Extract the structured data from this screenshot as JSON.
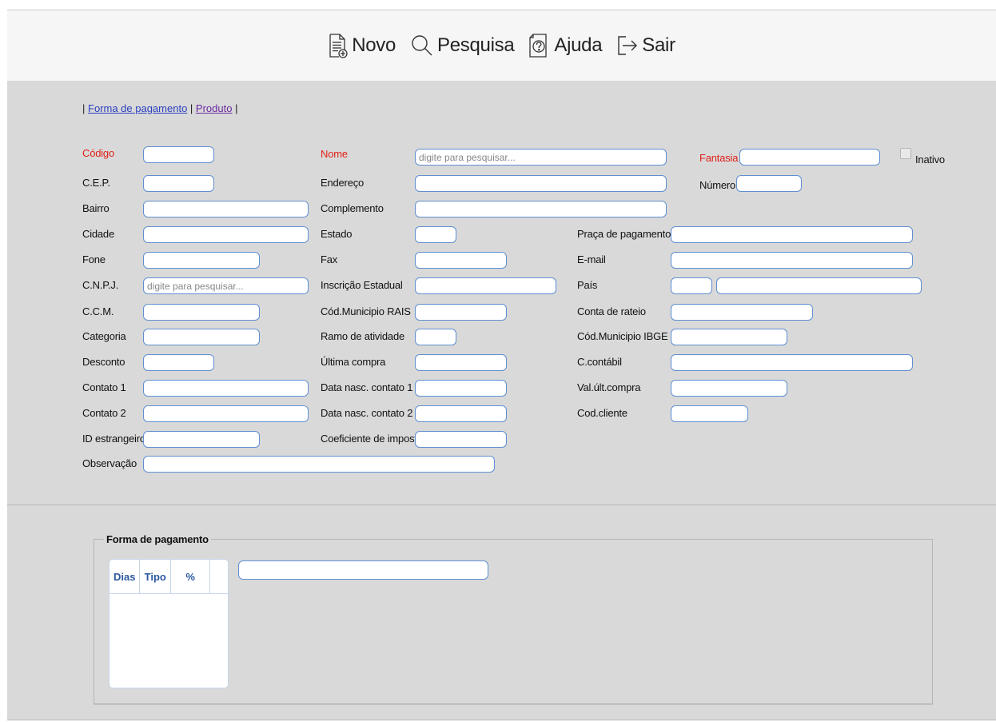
{
  "toolbar": {
    "novo": "Novo",
    "pesquisa": "Pesquisa",
    "ajuda": "Ajuda",
    "sair": "Sair"
  },
  "links": {
    "forma_pagamento": "Forma de pagamento",
    "produto": "Produto"
  },
  "form": {
    "codigo": "Código",
    "nome": "Nome",
    "nome_placeholder": "digite para pesquisar...",
    "fantasia": "Fantasia",
    "inativo": "Inativo",
    "cep": "C.E.P.",
    "endereco": "Endereço",
    "numero": "Número",
    "bairro": "Bairro",
    "complemento": "Complemento",
    "cidade": "Cidade",
    "estado": "Estado",
    "praca": "Praça de pagamento",
    "fone": "Fone",
    "fax": "Fax",
    "email": "E-mail",
    "cnpj": "C.N.P.J.",
    "cnpj_placeholder": "digite para pesquisar...",
    "inscricao": "Inscrição Estadual",
    "pais": "País",
    "ccm": "C.C.M.",
    "cod_rais": "Cód.Municipio RAIS",
    "conta_rateio": "Conta de rateio",
    "categoria": "Categoria",
    "ramo": "Ramo de atividade",
    "cod_ibge": "Cód.Municipio IBGE",
    "desconto": "Desconto",
    "ultima_compra": "Última compra",
    "ccontabil": "C.contábil",
    "contato1": "Contato 1",
    "data_nasc1": "Data nasc. contato 1",
    "val_ult": "Val.últ.compra",
    "contato2": "Contato 2",
    "data_nasc2": "Data nasc. contato 2",
    "cod_cliente": "Cod.cliente",
    "id_estrangeiro": "ID estrangeiro",
    "coef_imposto": "Coeficiente de imposto",
    "observacao": "Observação"
  },
  "forma_pagamento": {
    "legend": "Forma de pagamento",
    "columns": [
      "Dias",
      "Tipo",
      "%"
    ]
  },
  "colors": {
    "required": "#e0221a",
    "input_border": "#5f8fd1",
    "panel": "#d9d9d9",
    "grid_header": "#2a57a0"
  }
}
